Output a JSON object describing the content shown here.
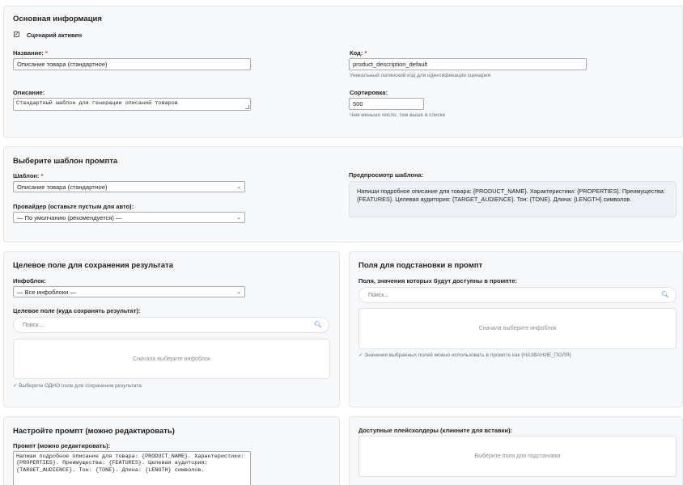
{
  "basic": {
    "title": "Основная информация",
    "active_label": "Сценарий активен",
    "name_label": "Название:",
    "name_value": "Описание товара (стандартное)",
    "code_label": "Код:",
    "code_value": "product_description_default",
    "code_hint": "Уникальный латинский код для идентификации сценария",
    "desc_label": "Описание:",
    "desc_value": "Стандартный шаблон для генерации описаний товаров",
    "sort_label": "Сортировка:",
    "sort_value": "500",
    "sort_hint": "Чем меньше число, тем выше в списке",
    "required_mark": "*"
  },
  "template": {
    "title": "Выберите шаблон промпта",
    "template_label": "Шаблон:",
    "template_value": "Описание товара (стандартное)",
    "provider_label": "Провайдер (оставьте пустым для авто):",
    "provider_value": "— По умолчанию (рекомендуется) —",
    "preview_label": "Предпросмотр шаблона:",
    "preview_text": "Напиши подробное описание для товара: {PRODUCT_NAME}. Характеристики: {PROPERTIES}. Преимущества: {FEATURES}. Целевая аудитория: {TARGET_AUDIENCE}. Тон: {TONE}. Длина: {LENGTH} символов."
  },
  "target": {
    "title": "Целевое поле для сохранения результата",
    "iblock_label": "Инфоблок:",
    "iblock_value": "— Все инфоблоки —",
    "field_label": "Целевое поле (куда сохранять результат):",
    "search_placeholder": "Поиск...",
    "empty_text": "Сначала выберите инфоблок",
    "hint": "✓ Выберите ОДНО поле для сохранения результата"
  },
  "fields": {
    "title": "Поля для подстановки в промпт",
    "subtitle": "Поля, значения которых будут доступны в промпте:",
    "search_placeholder": "Поиск...",
    "empty_text": "Сначала выберите инфоблок",
    "hint": "✓ Значения выбранных полей можно использовать в промпте как {НАЗВАНИЕ_ПОЛЯ}"
  },
  "prompt": {
    "title": "Настройте промпт (можно редактировать)",
    "label": "Промпт (можно редактировать):",
    "value": "Напиши подробное описание для товара: {PRODUCT_NAME}. Характеристики: {PROPERTIES}. Преимущества: {FEATURES}. Целевая аудитория: {TARGET_AUDIENCE}. Тон: {TONE}. Длина: {LENGTH} символов."
  },
  "placeholders": {
    "title": "Доступные плейсхолдеры (кликните для вставки):",
    "empty_text": "Выберите поля для подстановки"
  },
  "icons": {
    "checkbox": "checkmark-icon",
    "search": "search-icon",
    "select": "chevron-down-icon"
  },
  "colors": {
    "required": "#dd3333",
    "accent": "#2a6ad6"
  }
}
